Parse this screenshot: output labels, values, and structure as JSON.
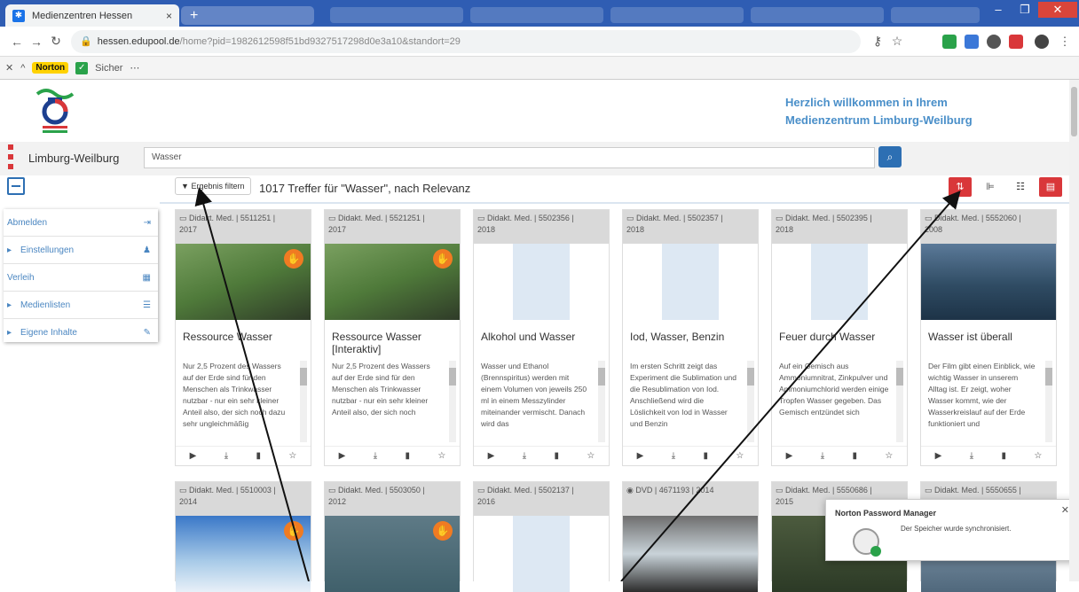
{
  "browser": {
    "active_tab_title": "Medienzentren Hessen",
    "url_host": "hessen.edupool.de",
    "url_path": "/home?pid=1982612598f51bd9327517298d0e3a10&standort=29",
    "extensions": [
      "norton-safe-web",
      "green-ext",
      "blue-ext",
      "github-ext",
      "red-ext",
      "chrome-profile"
    ]
  },
  "norton_bar": {
    "brand": "Norton",
    "safe_label": "Sicher"
  },
  "site": {
    "welcome_line1": "Herzlich willkommen in Ihrem",
    "welcome_line2": "Medienzentrum Limburg-Weilburg",
    "location": "Limburg-Weilburg",
    "search_value": "Wasser"
  },
  "sidebar": {
    "items": [
      {
        "label": "Abmelden",
        "icon": "logout-icon"
      },
      {
        "label": "Einstellungen",
        "icon": "user-icon"
      },
      {
        "label": "Verleih",
        "icon": "calendar-icon"
      },
      {
        "label": "Medienlisten",
        "icon": "list-icon"
      },
      {
        "label": "Eigene Inhalte",
        "icon": "edit-icon"
      }
    ]
  },
  "results": {
    "filter_label": "Ergebnis filtern",
    "summary": "1017 Treffer für \"Wasser\", nach Relevanz"
  },
  "cards": [
    {
      "meta": "Didakt. Med. | 5511251 |",
      "year": "2017",
      "title": "Ressource Wasser",
      "desc": "Nur 2,5 Prozent des Wassers auf der Erde sind für den Menschen als Trinkwasser nutzbar - nur ein sehr kleiner Anteil also, der sich noch dazu sehr ungleichmäßig"
    },
    {
      "meta": "Didakt. Med. | 5521251 |",
      "year": "2017",
      "title": "Ressource Wasser [Interaktiv]",
      "desc": "Nur 2,5 Prozent des Wassers auf der Erde sind für den Menschen als Trinkwasser nutzbar - nur ein sehr kleiner Anteil also, der sich noch"
    },
    {
      "meta": "Didakt. Med. | 5502356 |",
      "year": "2018",
      "title": "Alkohol und Wasser",
      "desc": "Wasser und Ethanol (Brennspiritus) werden mit einem Volumen von jeweils 250 ml in einem Messzylinder miteinander vermischt. Danach wird das"
    },
    {
      "meta": "Didakt. Med. | 5502357 |",
      "year": "2018",
      "title": "Iod, Wasser, Benzin",
      "desc": "Im ersten Schritt zeigt das Experiment die Sublimation und die Resublimation von Iod. Anschließend wird die Löslichkeit von Iod in Wasser und Benzin"
    },
    {
      "meta": "Didakt. Med. | 5502395 |",
      "year": "2018",
      "title": "Feuer durch Wasser",
      "desc": "Auf ein Gemisch aus Ammoniumnitrat, Zinkpulver und Ammoniumchlorid werden einige Tropfen Wasser gegeben. Das Gemisch entzündet sich"
    },
    {
      "meta": "Didakt. Med. | 5552060 |",
      "year": "2008",
      "title": "Wasser ist überall",
      "desc": "Der Film gibt einen Einblick, wie wichtig Wasser in unserem Alltag ist. Er zeigt, woher Wasser kommt, wie der Wasserkreislauf auf der Erde funktioniert und"
    }
  ],
  "cards_row2": [
    {
      "meta": "Didakt. Med. | 5510003 |",
      "year": "2014"
    },
    {
      "meta": "Didakt. Med. | 5503050 |",
      "year": "2012"
    },
    {
      "meta": "Didakt. Med. | 5502137 |",
      "year": "2016"
    },
    {
      "meta": "DVD | 4671193 | 2014",
      "year": ""
    },
    {
      "meta": "Didakt. Med. | 5550686 |",
      "year": "2015"
    },
    {
      "meta": "Didakt. Med. | 5550655 |",
      "year": ""
    }
  ],
  "popup": {
    "title": "Norton Password Manager",
    "message": "Der Speicher wurde synchronisiert."
  },
  "colors": {
    "accent_blue": "#2d6fb3",
    "accent_red": "#d9373a",
    "badge_orange": "#f07b22",
    "welcome_blue": "#4a8fc9"
  }
}
